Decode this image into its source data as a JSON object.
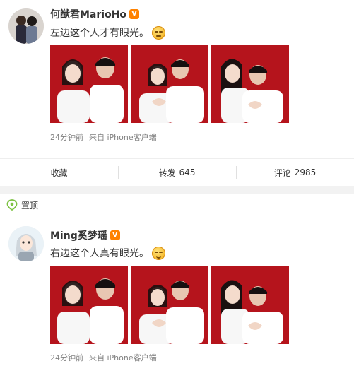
{
  "posts": [
    {
      "author": "何猷君MarioHo",
      "verified_badge": "V",
      "text": "左边这个人才有眼光。",
      "emoji": "unamused-face-emoji",
      "time": "24分钟前",
      "source": "来自 iPhone客户端",
      "actions": {
        "favorite": "收藏",
        "repost_label": "转发",
        "repost_count": "645",
        "comment_label": "评论",
        "comment_count": "2985"
      }
    },
    {
      "author": "Ming奚梦瑶",
      "verified_badge": "V",
      "text": "右边这个人真有眼光。",
      "emoji": "smiling-face-emoji",
      "time": "24分钟前",
      "source": "来自 iPhone客户端"
    }
  ],
  "pinned_label": "置顶",
  "colors": {
    "photo_background": "#b5141c",
    "verified_badge": "#ff8200",
    "pin_icon": "#7cc242"
  }
}
